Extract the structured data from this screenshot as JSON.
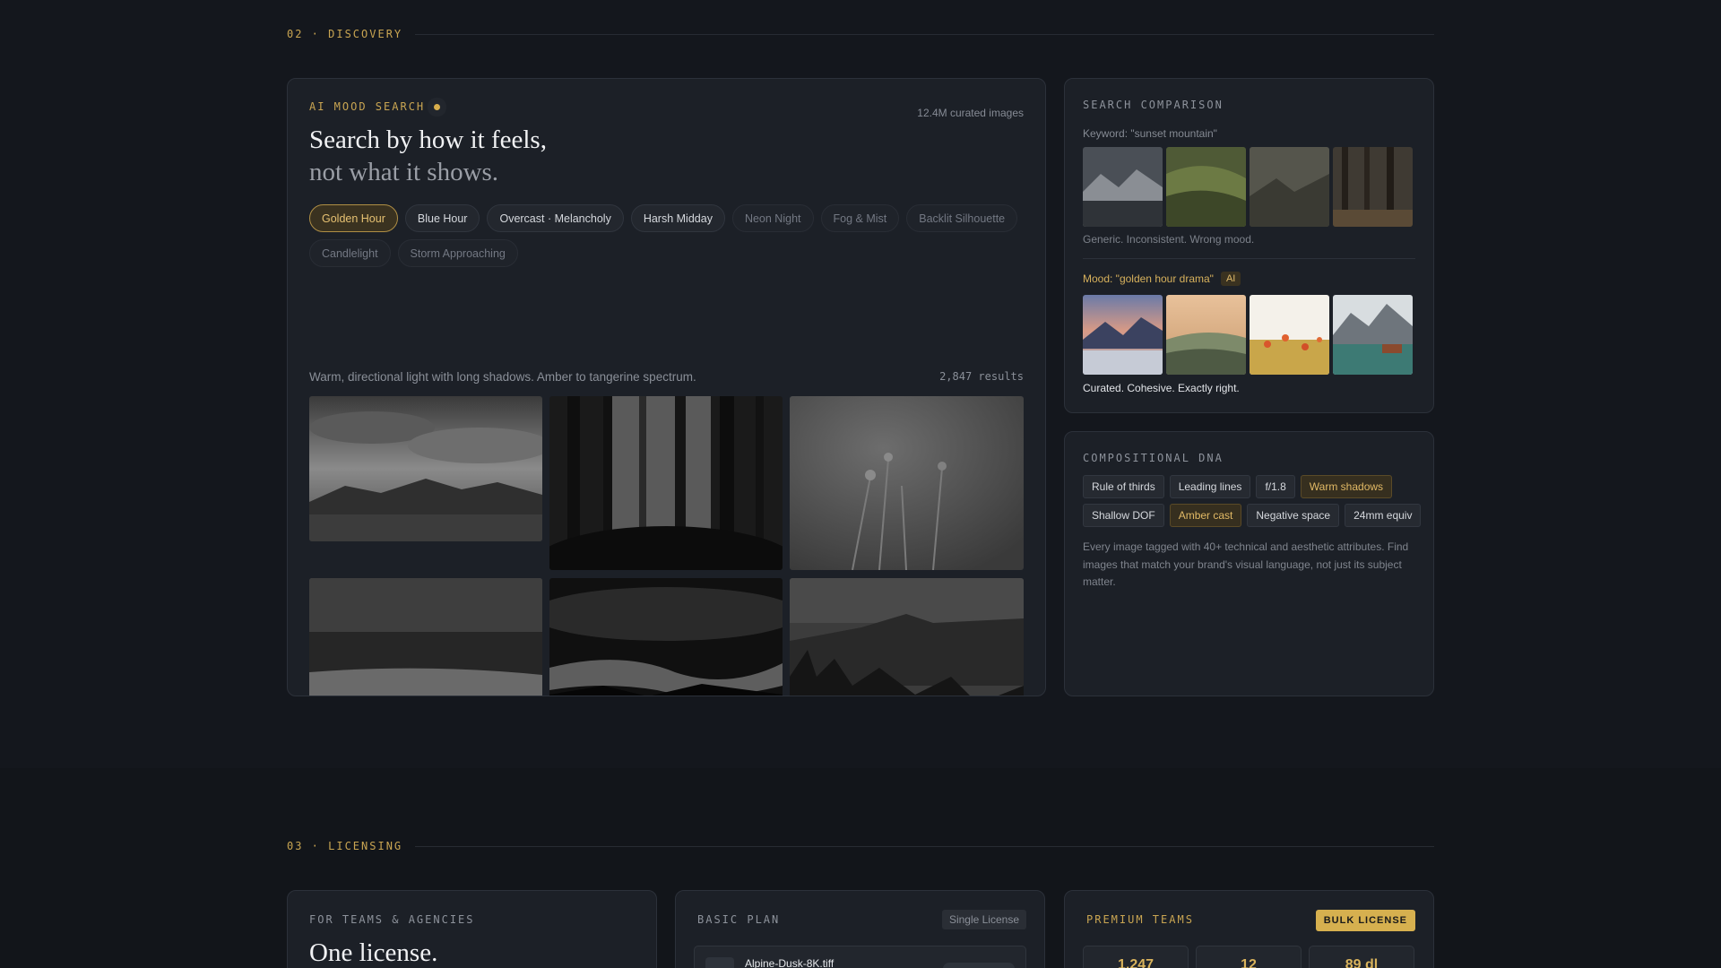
{
  "discovery": {
    "section_label": "02 · DISCOVERY",
    "mood_search": {
      "tag": "AI MOOD SEARCH",
      "meta": "12.4M curated images",
      "headline": "Search by how it feels,",
      "subheadline": "not what it shows.",
      "chips": [
        {
          "label": "Golden Hour",
          "state": "active"
        },
        {
          "label": "Blue Hour",
          "state": "normal"
        },
        {
          "label": "Overcast · Melancholy",
          "state": "normal"
        },
        {
          "label": "Harsh Midday",
          "state": "normal"
        },
        {
          "label": "Neon Night",
          "state": "dim"
        },
        {
          "label": "Fog & Mist",
          "state": "dim"
        },
        {
          "label": "Backlit Silhouette",
          "state": "dim"
        },
        {
          "label": "Candlelight",
          "state": "dim"
        },
        {
          "label": "Storm Approaching",
          "state": "dim"
        }
      ],
      "description": "Warm, directional light with long shadows. Amber to tangerine spectrum.",
      "results": "2,847 results"
    },
    "comparison": {
      "title": "SEARCH COMPARISON",
      "keyword_label": "Keyword: \"sunset mountain\"",
      "keyword_caption": "Generic. Inconsistent. Wrong mood.",
      "mood_label": "Mood: \"golden hour drama\"",
      "ai_badge": "AI",
      "mood_caption": "Curated. Cohesive. Exactly right."
    },
    "dna": {
      "title": "COMPOSITIONAL DNA",
      "tags": [
        {
          "label": "Rule of thirds",
          "warm": false
        },
        {
          "label": "Leading lines",
          "warm": false
        },
        {
          "label": "f/1.8",
          "warm": false
        },
        {
          "label": "Warm shadows",
          "warm": true
        },
        {
          "label": "Shallow DOF",
          "warm": false
        },
        {
          "label": "Amber cast",
          "warm": true
        },
        {
          "label": "Negative space",
          "warm": false
        },
        {
          "label": "24mm equiv",
          "warm": false
        }
      ],
      "description": "Every image tagged with 40+ technical and aesthetic attributes. Find images that match your brand's visual language, not just its subject matter."
    }
  },
  "licensing": {
    "section_label": "03 · LICENSING",
    "teams": {
      "title": "FOR TEAMS & AGENCIES",
      "headline": "One license."
    },
    "basic": {
      "title": "BASIC PLAN",
      "badge": "Single License",
      "file_name": "Alpine-Dusk-8K.tiff"
    },
    "premium": {
      "title": "PREMIUM TEAMS",
      "badge": "BULK LICENSE",
      "stats": [
        "1,247",
        "12",
        "89 dl"
      ]
    }
  },
  "colors": {
    "accent": "#c9a552",
    "background": "#14171d",
    "card": "#1c2027"
  }
}
